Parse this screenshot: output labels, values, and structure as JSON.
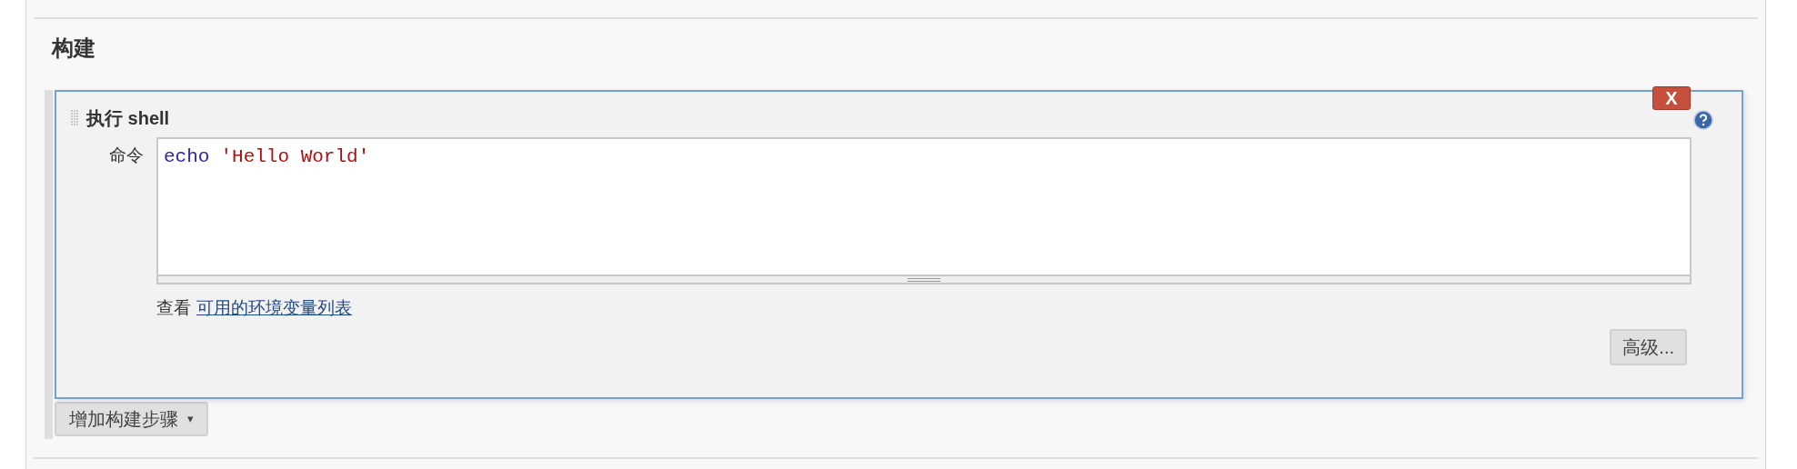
{
  "section": {
    "title": "构建"
  },
  "step": {
    "title": "执行 shell",
    "delete_label": "X",
    "field_label": "命令",
    "code": [
      {
        "kind": "keyword",
        "text": "echo"
      },
      {
        "kind": "string",
        "text": "'Hello World'"
      }
    ],
    "hint": {
      "prefix": "查看",
      "link": "可用的环境变量列表"
    },
    "advanced_button": "高级..."
  },
  "add_step_button": {
    "label": "增加构建步骤",
    "caret": "▾"
  }
}
